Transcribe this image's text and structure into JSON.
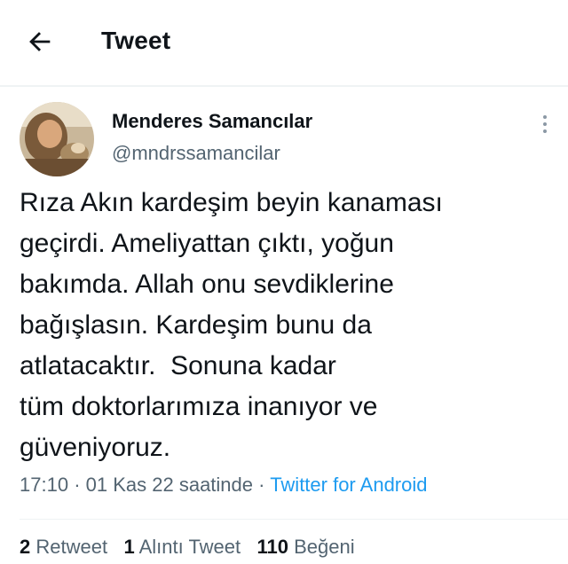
{
  "header": {
    "title": "Tweet",
    "back_icon": "arrow-left-icon"
  },
  "tweet": {
    "author_name": "Menderes Samancılar",
    "author_handle": "@mndrssamancilar",
    "more_icon": "more-vertical-icon",
    "text": "Rıza Akın kardeşim beyin kanaması\ngeçirdi. Ameliyattan çıktı, yoğun\nbakımda. Allah onu sevdiklerine\nbağışlasın. Kardeşim bunu da\natlatacaktır.  Sonuna kadar\ntüm doktorlarımıza inanıyor ve\ngüveniyoruz.",
    "time": "17:10",
    "separator": "·",
    "date": "01 Kas 22 saatinde",
    "source": "Twitter for Android"
  },
  "stats": {
    "retweet_count": "2",
    "retweet_label": "Retweet",
    "quote_count": "1",
    "quote_label": "Alıntı Tweet",
    "like_count": "110",
    "like_label": "Beğeni"
  },
  "colors": {
    "accent": "#1d9bf0",
    "secondary_text": "#536471",
    "primary_text": "#0f1419"
  }
}
